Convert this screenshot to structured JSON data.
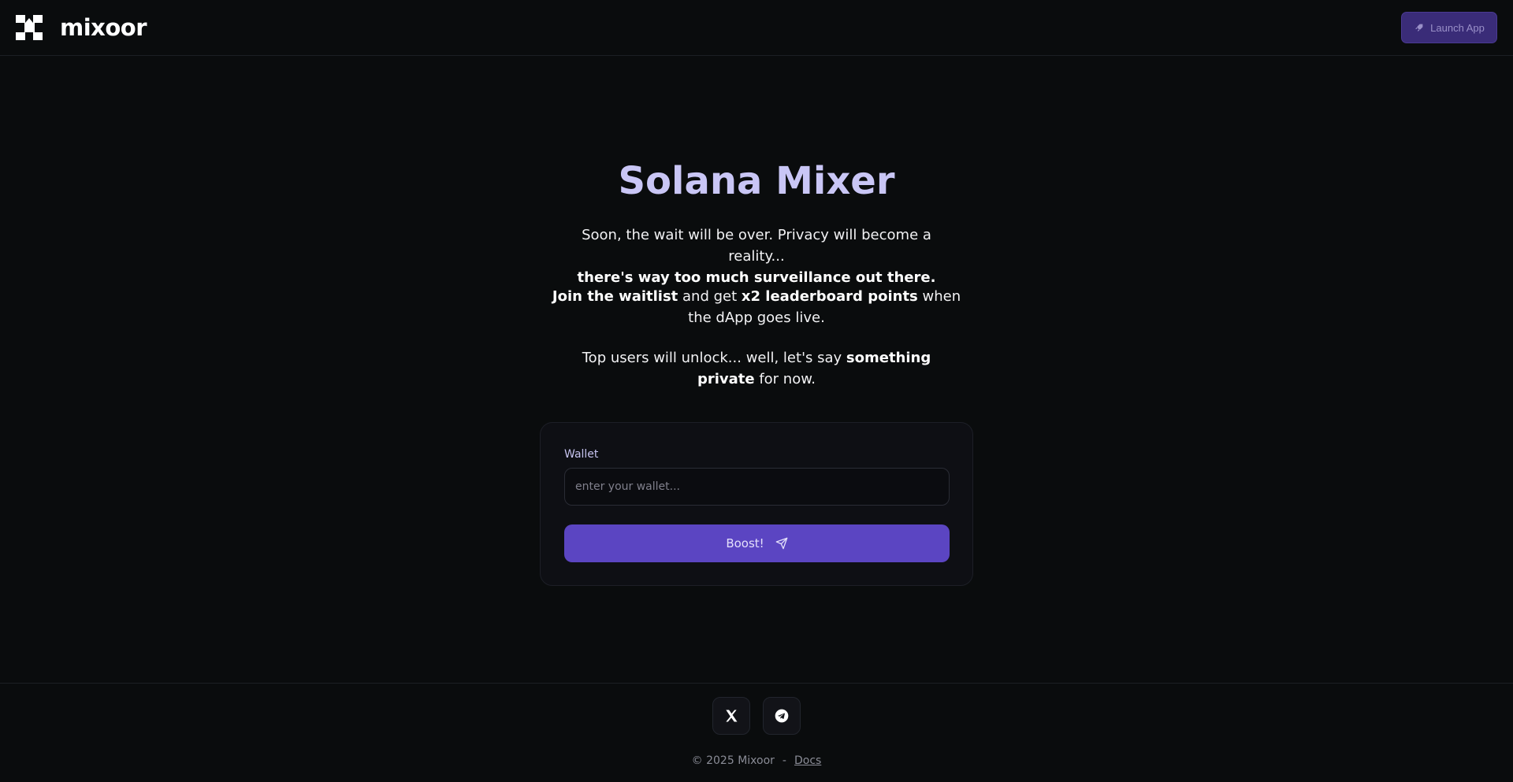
{
  "header": {
    "logo_text": "mixoor",
    "launch_label": "Launch App"
  },
  "hero": {
    "title": "Solana Mixer",
    "p1_line1": "Soon, the wait will be over. Privacy will become a reality...",
    "p1_bold": "there's way too much surveillance out there.",
    "p2_bold1": "Join the waitlist",
    "p2_mid": " and get ",
    "p2_bold2": "x2 leaderboard points",
    "p2_end": " when the dApp goes live.",
    "p3_start": "Top users will unlock... well, let's say ",
    "p3_bold": "something private",
    "p3_end": " for now."
  },
  "form": {
    "wallet_label": "Wallet",
    "wallet_placeholder": "enter your wallet...",
    "wallet_value": "",
    "boost_label": "Boost!"
  },
  "footer": {
    "copyright": "© 2025 Mixoor",
    "separator": "-",
    "docs_label": "Docs"
  },
  "icons": {
    "launch": "rocket-icon",
    "boost": "send-icon",
    "social_x": "x-twitter-icon",
    "social_tg": "telegram-icon"
  },
  "colors": {
    "background": "#0a0c0d",
    "accent": "#5b45c2",
    "title": "#c9c6f5"
  }
}
